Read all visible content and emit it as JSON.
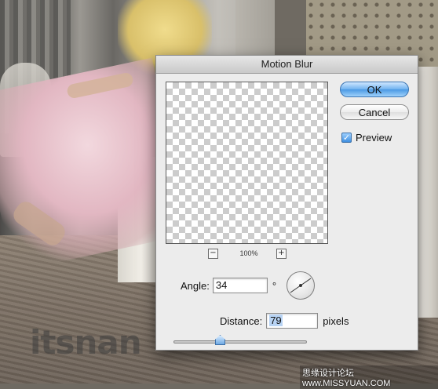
{
  "dialog": {
    "title": "Motion Blur",
    "ok_label": "OK",
    "cancel_label": "Cancel",
    "preview_label": "Preview",
    "preview_checked": true,
    "zoom": {
      "minus_label": "−",
      "plus_label": "+",
      "level": "100%"
    },
    "angle": {
      "label": "Angle:",
      "value": "34",
      "unit": "°"
    },
    "distance": {
      "label": "Distance:",
      "value": "79",
      "unit": "pixels",
      "slider_fraction": 0.35
    }
  },
  "watermarks": {
    "left": "itsnan",
    "right": "思缘设计论坛 www.MISSYUAN.COM"
  },
  "colors": {
    "accent": "#4a99e4"
  },
  "icons": {
    "checkbox": "checkmark-icon",
    "dial": "angle-dial-icon"
  }
}
